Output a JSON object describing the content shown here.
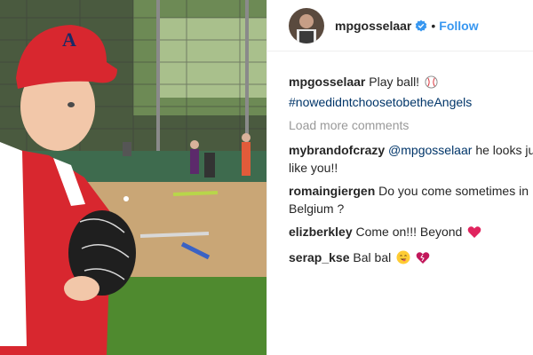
{
  "post": {
    "username": "mpgosselaar",
    "follow_label": "Follow",
    "dot": "•",
    "icons": {
      "verified": "verified-badge-icon",
      "baseball": "baseball-icon"
    },
    "colors": {
      "link": "#3897f0",
      "hashtag": "#003569",
      "muted": "#999999"
    }
  },
  "caption": {
    "user": "mpgosselaar",
    "text": "Play ball!",
    "hashtag": "#nowedidntchoosetobetheAngels"
  },
  "load_more": "Load more comments",
  "comments": [
    {
      "user": "mybrandofcrazy",
      "mention": "@mpgosselaar",
      "text": "he looks just like you!!"
    },
    {
      "user": "romaingiergen",
      "text": "Do you come sometimes in Belgium ?"
    },
    {
      "user": "elizberkley",
      "text": "Come on!!! Beyond",
      "emoji": "red-heart-icon"
    },
    {
      "user": "serap_kse",
      "text": "Bal bal",
      "emoji": "smiling-face-icon, heart-icon"
    }
  ]
}
